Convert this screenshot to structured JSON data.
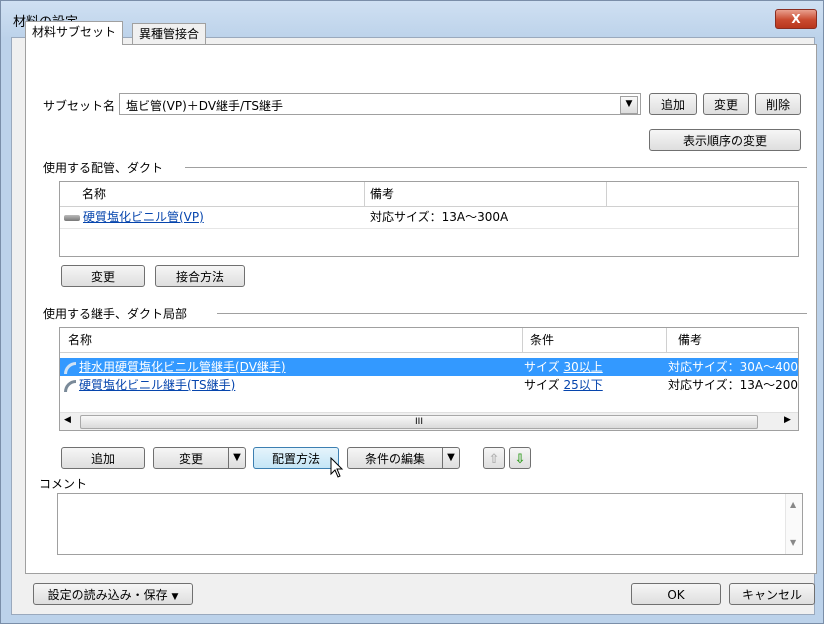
{
  "window": {
    "title": "材料の設定",
    "close_label": "X"
  },
  "tabs": [
    {
      "label": "材料サブセット"
    },
    {
      "label": "異種管接合"
    }
  ],
  "subset": {
    "label": "サブセット名",
    "value": "塩ビ管(VP)＋DV継手/TS継手",
    "add_label": "追加",
    "change_label": "変更",
    "delete_label": "削除",
    "reorder_label": "表示順序の変更"
  },
  "pipes": {
    "section_label": "使用する配管、ダクト",
    "headers": {
      "name": "名称",
      "note": "備考"
    },
    "rows": [
      {
        "name": "硬質塩化ビニル管(VP)",
        "note": "対応サイズ：13A～300A"
      }
    ],
    "change_label": "変更",
    "connect_label": "接合方法"
  },
  "fittings": {
    "section_label": "使用する継手、ダクト局部",
    "headers": {
      "name": "名称",
      "condition": "条件",
      "note": "備考"
    },
    "rows": [
      {
        "name": "排水用硬質塩化ビニル管継手(DV継手)",
        "cond_prefix": "サイズ",
        "cond_value": "30以上",
        "note": "対応サイズ：30A～400"
      },
      {
        "name": "硬質塩化ビニル継手(TS継手)",
        "cond_prefix": "サイズ",
        "cond_value": "25以下",
        "note": "対応サイズ：13A～200"
      }
    ],
    "scroll_thumb_label": "III",
    "add_label": "追加",
    "change_label": "変更",
    "placement_label": "配置方法",
    "edit_condition_label": "条件の編集"
  },
  "comment": {
    "label": "コメント",
    "value": ""
  },
  "footer": {
    "load_save_label": "設定の読み込み・保存",
    "ok_label": "OK",
    "cancel_label": "キャンセル"
  },
  "colors": {
    "selection": "#3399ff",
    "link": "#0645ad",
    "title_gradient": "#bcd2ea"
  }
}
